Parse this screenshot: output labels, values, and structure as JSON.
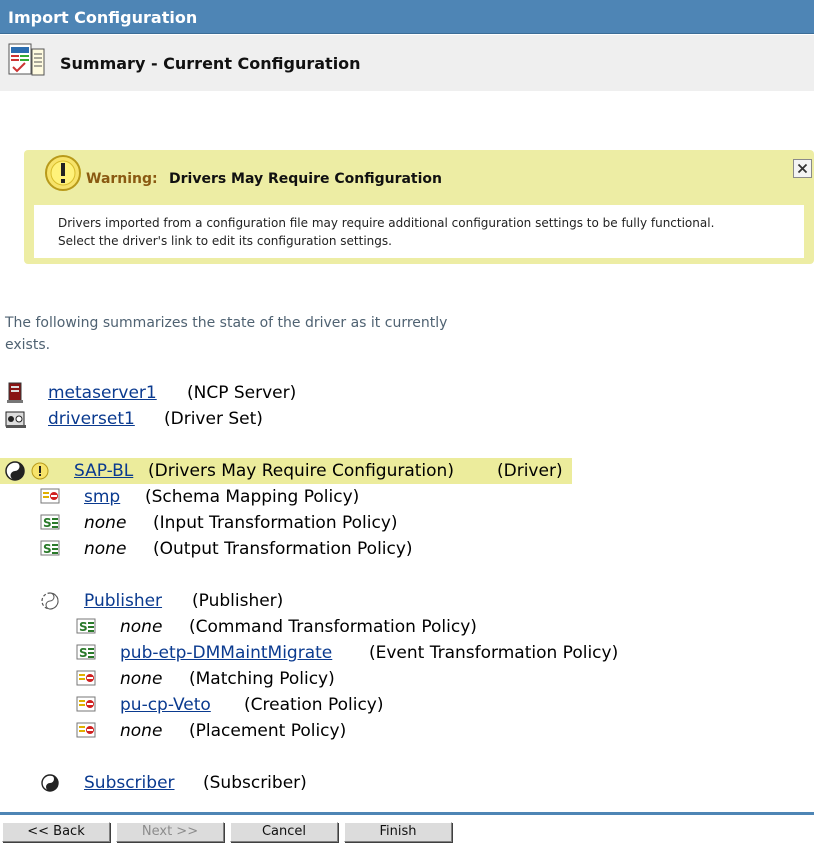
{
  "window": {
    "title": "Import Configuration"
  },
  "header": {
    "title": "Summary - Current Configuration"
  },
  "warning": {
    "label": "Warning:",
    "heading": "Drivers May Require Configuration",
    "line1": "Drivers imported from a configuration file may require additional configuration settings to be fully functional.",
    "line2": "Select the driver's link to edit its configuration settings."
  },
  "intro": "The following summarizes the state of the driver as it currently exists.",
  "tree": {
    "server": {
      "link": "metaserver1",
      "type": "(NCP Server)"
    },
    "driverset": {
      "link": "driverset1",
      "type": "(Driver Set)"
    },
    "driver": {
      "link": "SAP-BL",
      "status": "(Drivers May Require Configuration)",
      "type": "(Driver)"
    },
    "driver_policies": [
      {
        "name": "smp",
        "type": "(Schema Mapping Policy)"
      },
      {
        "name": "none",
        "type": "(Input Transformation Policy)"
      },
      {
        "name": "none",
        "type": "(Output Transformation Policy)"
      }
    ],
    "publisher": {
      "link": "Publisher",
      "type": "(Publisher)"
    },
    "publisher_policies": [
      {
        "name": "none",
        "type": "(Command Transformation Policy)"
      },
      {
        "name": "pub-etp-DMMaintMigrate",
        "type": "(Event Transformation Policy)"
      },
      {
        "name": "none",
        "type": "(Matching Policy)"
      },
      {
        "name": "pu-cp-Veto",
        "type": "(Creation Policy)"
      },
      {
        "name": "none",
        "type": "(Placement Policy)"
      }
    ],
    "subscriber": {
      "link": "Subscriber",
      "type": "(Subscriber)"
    }
  },
  "buttons": {
    "back": "<< Back",
    "next": "Next >>",
    "cancel": "Cancel",
    "finish": "Finish"
  },
  "colors": {
    "titlebar": "#4e85b5",
    "warning_bg": "#ededa4",
    "highlight": "#ecec9c",
    "link": "#0a3a8f"
  }
}
